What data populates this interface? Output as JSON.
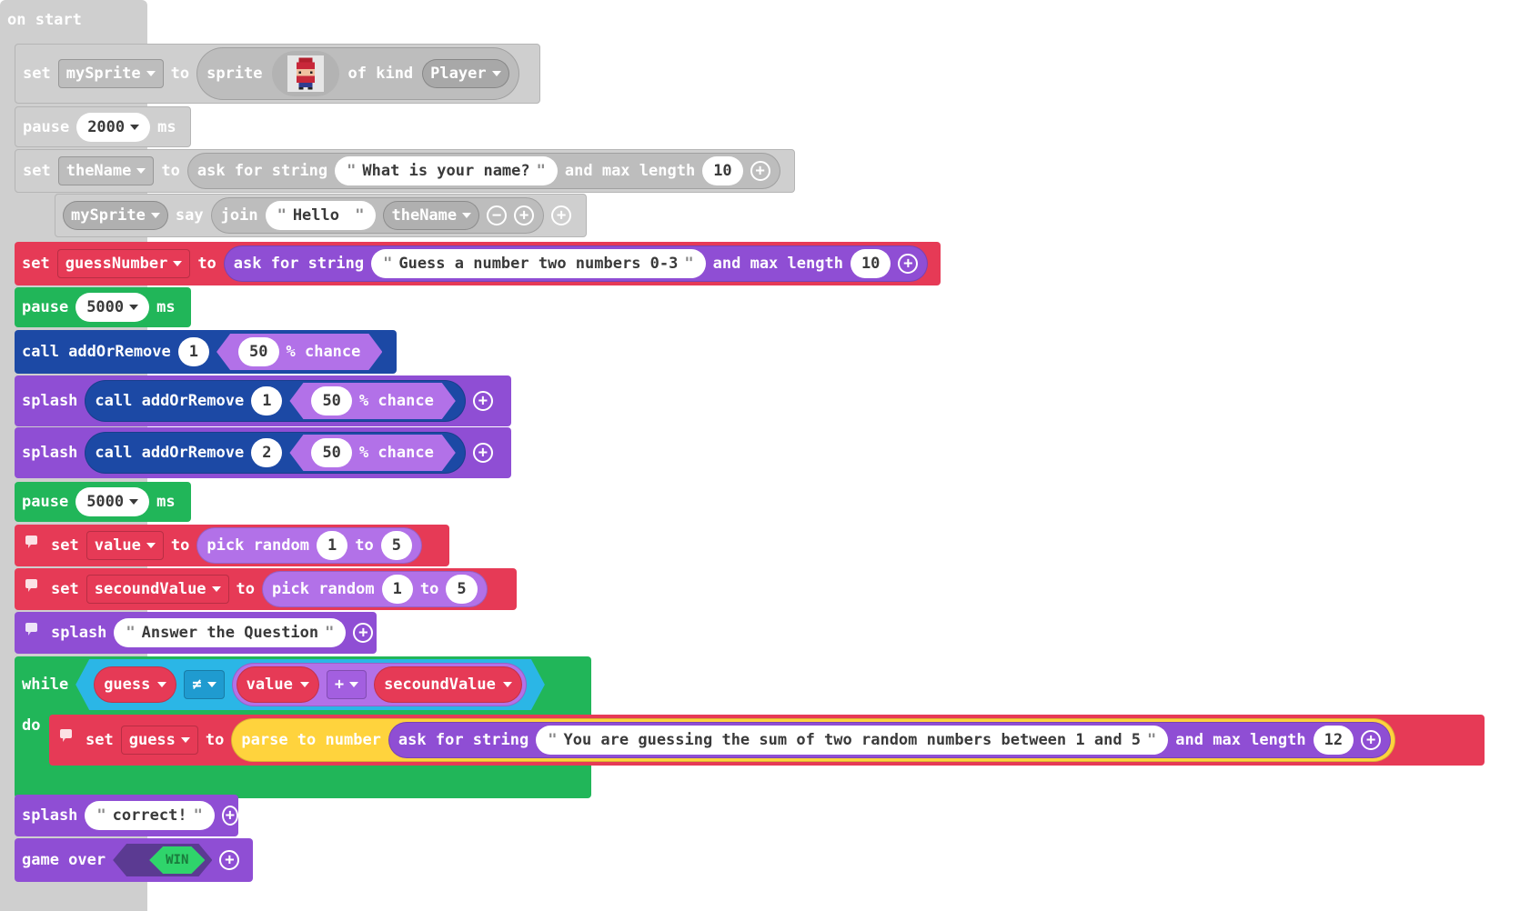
{
  "on_start": "on start",
  "block1": {
    "set": "set",
    "var": "mySprite",
    "to": "to",
    "sprite": "sprite",
    "of_kind": "of kind",
    "kind": "Player"
  },
  "block2": {
    "pause": "pause",
    "value": "2000",
    "ms": "ms"
  },
  "block3": {
    "set": "set",
    "var": "theName",
    "to": "to",
    "ask": "ask for string",
    "prompt": "What is your name?",
    "and_max": "and max length",
    "len": "10"
  },
  "block4": {
    "var": "mySprite",
    "say": "say",
    "join": "join",
    "text": "Hello ",
    "var2": "theName"
  },
  "block5": {
    "set": "set",
    "var": "guessNumber",
    "to": "to",
    "ask": "ask for string",
    "prompt": "Guess a number two numbers 0-3",
    "and_max": "and max length",
    "len": "10"
  },
  "block6": {
    "pause": "pause",
    "value": "5000",
    "ms": "ms"
  },
  "block7": {
    "call": "call addOrRemove",
    "arg": "1",
    "pct": "50",
    "chance": "% chance"
  },
  "block8": {
    "splash": "splash",
    "call": "call addOrRemove",
    "arg": "1",
    "pct": "50",
    "chance": "% chance"
  },
  "block9": {
    "splash": "splash",
    "call": "call addOrRemove",
    "arg": "2",
    "pct": "50",
    "chance": "% chance"
  },
  "block10": {
    "pause": "pause",
    "value": "5000",
    "ms": "ms"
  },
  "block11": {
    "set": "set",
    "var": "value",
    "to": "to",
    "pick": "pick random",
    "a": "1",
    "to2": "to",
    "b": "5"
  },
  "block12": {
    "set": "set",
    "var": "secoundValue",
    "to": "to",
    "pick": "pick random",
    "a": "1",
    "to2": "to",
    "b": "5"
  },
  "block13": {
    "splash": "splash",
    "text": "Answer the Question"
  },
  "while_block": {
    "while": "while",
    "guess": "guess",
    "neq": "≠",
    "value": "value",
    "op": "+",
    "second": "secoundValue",
    "do": "do"
  },
  "block14": {
    "set": "set",
    "var": "guess",
    "to": "to",
    "parse": "parse to number",
    "ask": "ask for string",
    "prompt": "You are guessing the sum of two random numbers between 1 and 5",
    "and_max": "and max length",
    "len": "12"
  },
  "block15": {
    "splash": "splash",
    "text": "correct!"
  },
  "block16": {
    "game_over": "game over",
    "win": "WIN"
  },
  "colors": {
    "gray": "#cfcfcf",
    "red": "#e63a56",
    "green": "#21b659",
    "purple": "#8f4ed4",
    "blue": "#1c49a5",
    "yellow": "#ffd33d",
    "cyan": "#2bb6e6"
  }
}
